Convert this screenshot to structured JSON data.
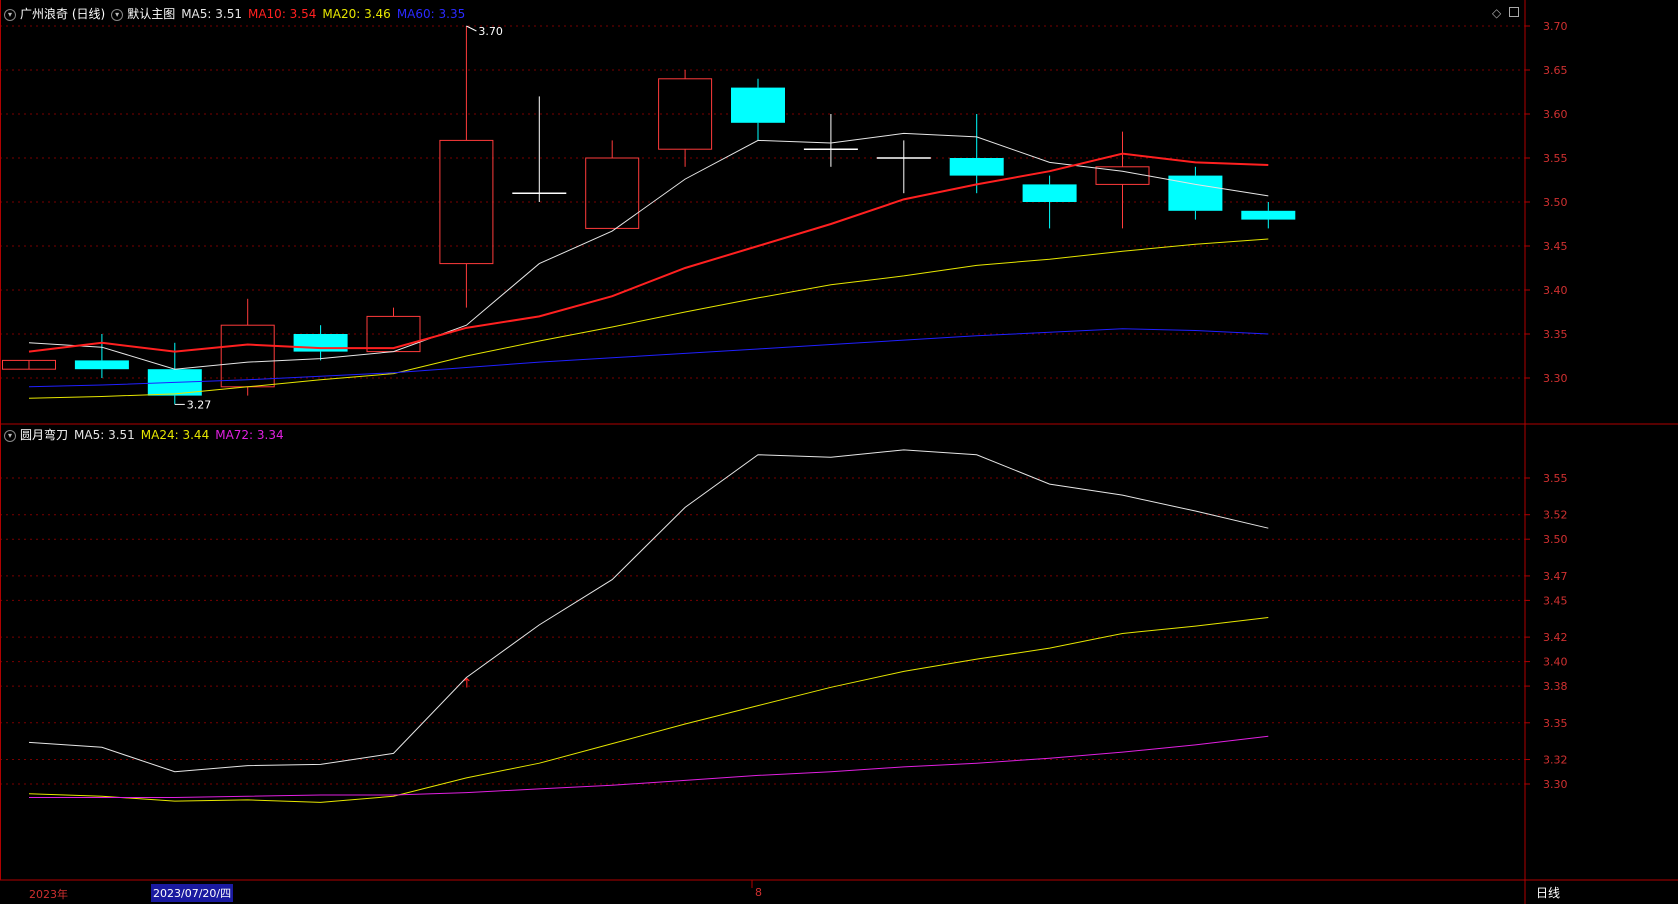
{
  "top_header": {
    "stock": "广州浪奇 (日线)",
    "template": "默认主图",
    "ma5": "MA5: 3.51",
    "ma10": "MA10: 3.54",
    "ma20": "MA20: 3.46",
    "ma60": "MA60: 3.35"
  },
  "bottom_header": {
    "indicator": "圆月弯刀",
    "ma5": "MA5: 3.51",
    "ma24": "MA24: 3.44",
    "ma72": "MA72: 3.34"
  },
  "footer": {
    "year": "2023年",
    "cursor_date": "2023/07/20/四",
    "month_mark": "8",
    "period_tab": "日线"
  },
  "colors": {
    "up": "#ff3b3b",
    "down": "#00ffff",
    "ma5": "#e6e6e6",
    "ma10": "#ff2020",
    "ma20": "#e6e600",
    "ma60": "#2020ff",
    "ma72": "#e020e0",
    "axis": "#b00000"
  },
  "chart_data": [
    {
      "type": "candlestick",
      "title": "广州浪奇 (日线)",
      "ylim": [
        3.25,
        3.72
      ],
      "y_ticks": [
        "3.30",
        "3.35",
        "3.40",
        "3.45",
        "3.50",
        "3.55",
        "3.60",
        "3.65",
        "3.70"
      ],
      "annotations": [
        {
          "label": "3.70",
          "candle": 6,
          "kind": "high"
        },
        {
          "label": "3.27",
          "candle": 2,
          "kind": "low"
        }
      ],
      "candles": [
        {
          "o": 3.31,
          "h": 3.31,
          "l": 3.31,
          "c": 3.32
        },
        {
          "o": 3.32,
          "h": 3.35,
          "l": 3.3,
          "c": 3.31
        },
        {
          "o": 3.31,
          "h": 3.34,
          "l": 3.27,
          "c": 3.28
        },
        {
          "o": 3.29,
          "h": 3.39,
          "l": 3.28,
          "c": 3.36
        },
        {
          "o": 3.35,
          "h": 3.36,
          "l": 3.32,
          "c": 3.33
        },
        {
          "o": 3.33,
          "h": 3.38,
          "l": 3.33,
          "c": 3.37
        },
        {
          "o": 3.43,
          "h": 3.7,
          "l": 3.38,
          "c": 3.57
        },
        {
          "o": 3.51,
          "h": 3.62,
          "l": 3.5,
          "c": 3.51
        },
        {
          "o": 3.47,
          "h": 3.57,
          "l": 3.47,
          "c": 3.55
        },
        {
          "o": 3.56,
          "h": 3.65,
          "l": 3.54,
          "c": 3.64
        },
        {
          "o": 3.63,
          "h": 3.64,
          "l": 3.57,
          "c": 3.59
        },
        {
          "o": 3.56,
          "h": 3.6,
          "l": 3.54,
          "c": 3.56
        },
        {
          "o": 3.55,
          "h": 3.57,
          "l": 3.51,
          "c": 3.55
        },
        {
          "o": 3.55,
          "h": 3.6,
          "l": 3.51,
          "c": 3.53
        },
        {
          "o": 3.52,
          "h": 3.53,
          "l": 3.47,
          "c": 3.5
        },
        {
          "o": 3.52,
          "h": 3.58,
          "l": 3.47,
          "c": 3.54
        },
        {
          "o": 3.53,
          "h": 3.54,
          "l": 3.48,
          "c": 3.49
        },
        {
          "o": 3.49,
          "h": 3.5,
          "l": 3.47,
          "c": 3.48
        }
      ],
      "series": [
        {
          "name": "MA5",
          "color_key": "ma5",
          "width": 1,
          "values": [
            3.34,
            3.335,
            3.31,
            3.318,
            3.322,
            3.33,
            3.36,
            3.43,
            3.467,
            3.526,
            3.57,
            3.567,
            3.578,
            3.574,
            3.545,
            3.535,
            3.52,
            3.507
          ]
        },
        {
          "name": "MA10",
          "color_key": "ma10",
          "width": 2,
          "values": [
            3.33,
            3.34,
            3.33,
            3.338,
            3.334,
            3.334,
            3.357,
            3.37,
            3.393,
            3.425,
            3.45,
            3.475,
            3.503,
            3.52,
            3.535,
            3.555,
            3.545,
            3.542
          ]
        },
        {
          "name": "MA20",
          "color_key": "ma20",
          "width": 1,
          "values": [
            3.277,
            3.279,
            3.282,
            3.29,
            3.298,
            3.305,
            3.325,
            3.342,
            3.358,
            3.375,
            3.391,
            3.406,
            3.416,
            3.428,
            3.435,
            3.444,
            3.452,
            3.458
          ]
        },
        {
          "name": "MA60",
          "color_key": "ma60",
          "width": 1,
          "values": [
            3.29,
            3.292,
            3.295,
            3.298,
            3.302,
            3.306,
            3.312,
            3.318,
            3.323,
            3.328,
            3.333,
            3.338,
            3.343,
            3.348,
            3.352,
            3.356,
            3.354,
            3.35
          ]
        }
      ]
    },
    {
      "type": "line",
      "title": "圆月弯刀",
      "ylim": [
        3.28,
        3.57
      ],
      "y_ticks": [
        "3.30",
        "3.32",
        "3.35",
        "3.38",
        "3.40",
        "3.42",
        "3.45",
        "3.47",
        "3.50",
        "3.52",
        "3.55"
      ],
      "marker": {
        "candle": 6,
        "label": "↑"
      },
      "series": [
        {
          "name": "MA5",
          "color_key": "ma5",
          "values": [
            3.334,
            3.33,
            3.31,
            3.315,
            3.316,
            3.325,
            3.387,
            3.43,
            3.467,
            3.526,
            3.569,
            3.567,
            3.573,
            3.569,
            3.545,
            3.536,
            3.523,
            3.509
          ]
        },
        {
          "name": "MA24",
          "color_key": "ma20",
          "values": [
            3.292,
            3.29,
            3.286,
            3.287,
            3.285,
            3.29,
            3.305,
            3.317,
            3.333,
            3.349,
            3.364,
            3.379,
            3.392,
            3.402,
            3.411,
            3.423,
            3.429,
            3.436
          ]
        },
        {
          "name": "MA72",
          "color_key": "ma72",
          "values": [
            3.289,
            3.289,
            3.289,
            3.29,
            3.291,
            3.291,
            3.293,
            3.296,
            3.299,
            3.303,
            3.307,
            3.31,
            3.314,
            3.317,
            3.321,
            3.326,
            3.332,
            3.339
          ]
        }
      ]
    }
  ]
}
